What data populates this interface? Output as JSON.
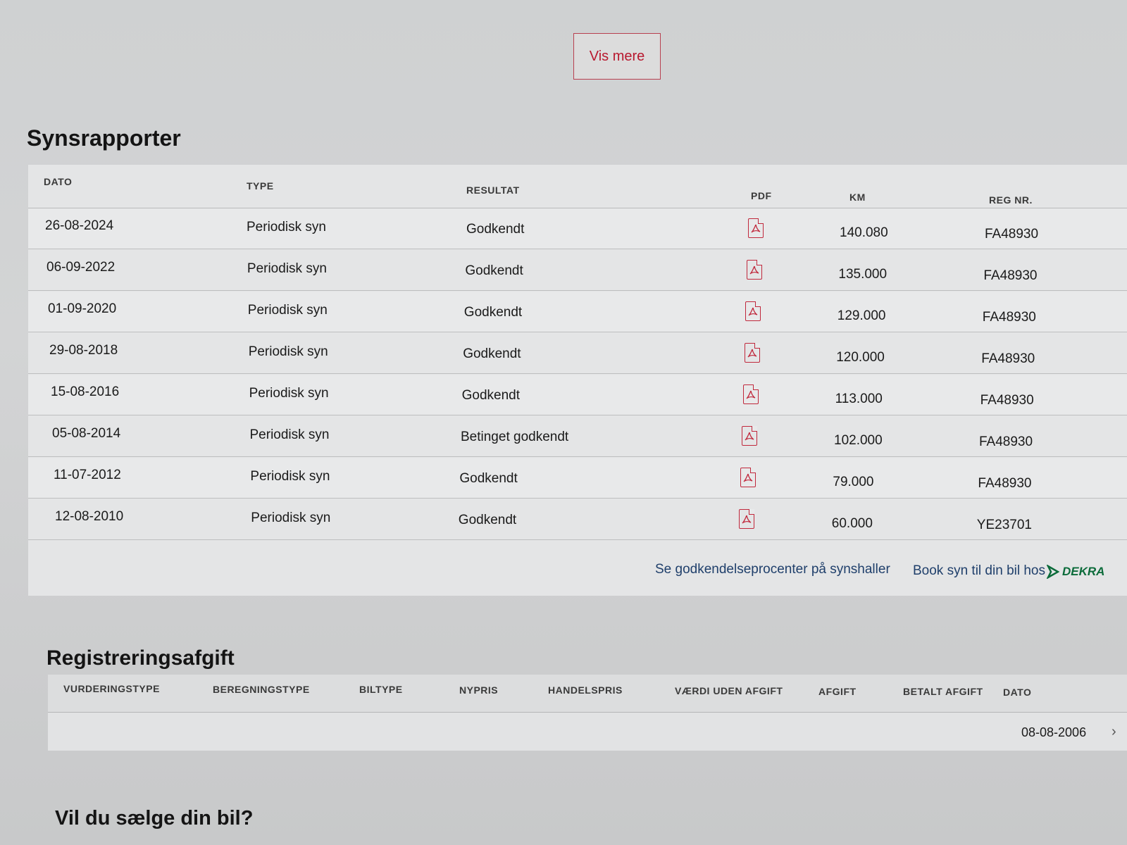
{
  "vis_mere_label": "Vis mere",
  "synsrapporter": {
    "title": "Synsrapporter",
    "headers": {
      "dato": "DATO",
      "type": "TYPE",
      "resultat": "RESULTAT",
      "pdf": "PDF",
      "km": "KM",
      "reg": "REG NR."
    },
    "rows": [
      {
        "dato": "26-08-2024",
        "type": "Periodisk syn",
        "resultat": "Godkendt",
        "km": "140.080",
        "reg": "FA48930"
      },
      {
        "dato": "06-09-2022",
        "type": "Periodisk syn",
        "resultat": "Godkendt",
        "km": "135.000",
        "reg": "FA48930"
      },
      {
        "dato": "01-09-2020",
        "type": "Periodisk syn",
        "resultat": "Godkendt",
        "km": "129.000",
        "reg": "FA48930"
      },
      {
        "dato": "29-08-2018",
        "type": "Periodisk syn",
        "resultat": "Godkendt",
        "km": "120.000",
        "reg": "FA48930"
      },
      {
        "dato": "15-08-2016",
        "type": "Periodisk syn",
        "resultat": "Godkendt",
        "km": "113.000",
        "reg": "FA48930"
      },
      {
        "dato": "05-08-2014",
        "type": "Periodisk syn",
        "resultat": "Betinget godkendt",
        "km": "102.000",
        "reg": "FA48930"
      },
      {
        "dato": "11-07-2012",
        "type": "Periodisk syn",
        "resultat": "Godkendt",
        "km": "79.000",
        "reg": "FA48930"
      },
      {
        "dato": "12-08-2010",
        "type": "Periodisk syn",
        "resultat": "Godkendt",
        "km": "60.000",
        "reg": "YE23701"
      }
    ],
    "link_godkendelse": "Se godkendelseprocenter på synshaller",
    "link_book": "Book syn til din bil hos",
    "dekra_logo": "DEKRA",
    "pdf_icon": "pdf-file-icon",
    "accent_color": "#c0283c"
  },
  "registreringsafgift": {
    "title": "Registreringsafgift",
    "headers": [
      "VURDERINGSTYPE",
      "BEREGNINGSTYPE",
      "BILTYPE",
      "NYPRIS",
      "HANDELSPRIS",
      "VÆRDI UDEN AFGIFT",
      "AFGIFT",
      "BETALT AFGIFT",
      "DATO"
    ],
    "row": {
      "dato": "08-08-2006"
    },
    "expand_icon": "chevron-right-icon"
  },
  "vil_du_saelge_title": "Vil du sælge din bil?"
}
